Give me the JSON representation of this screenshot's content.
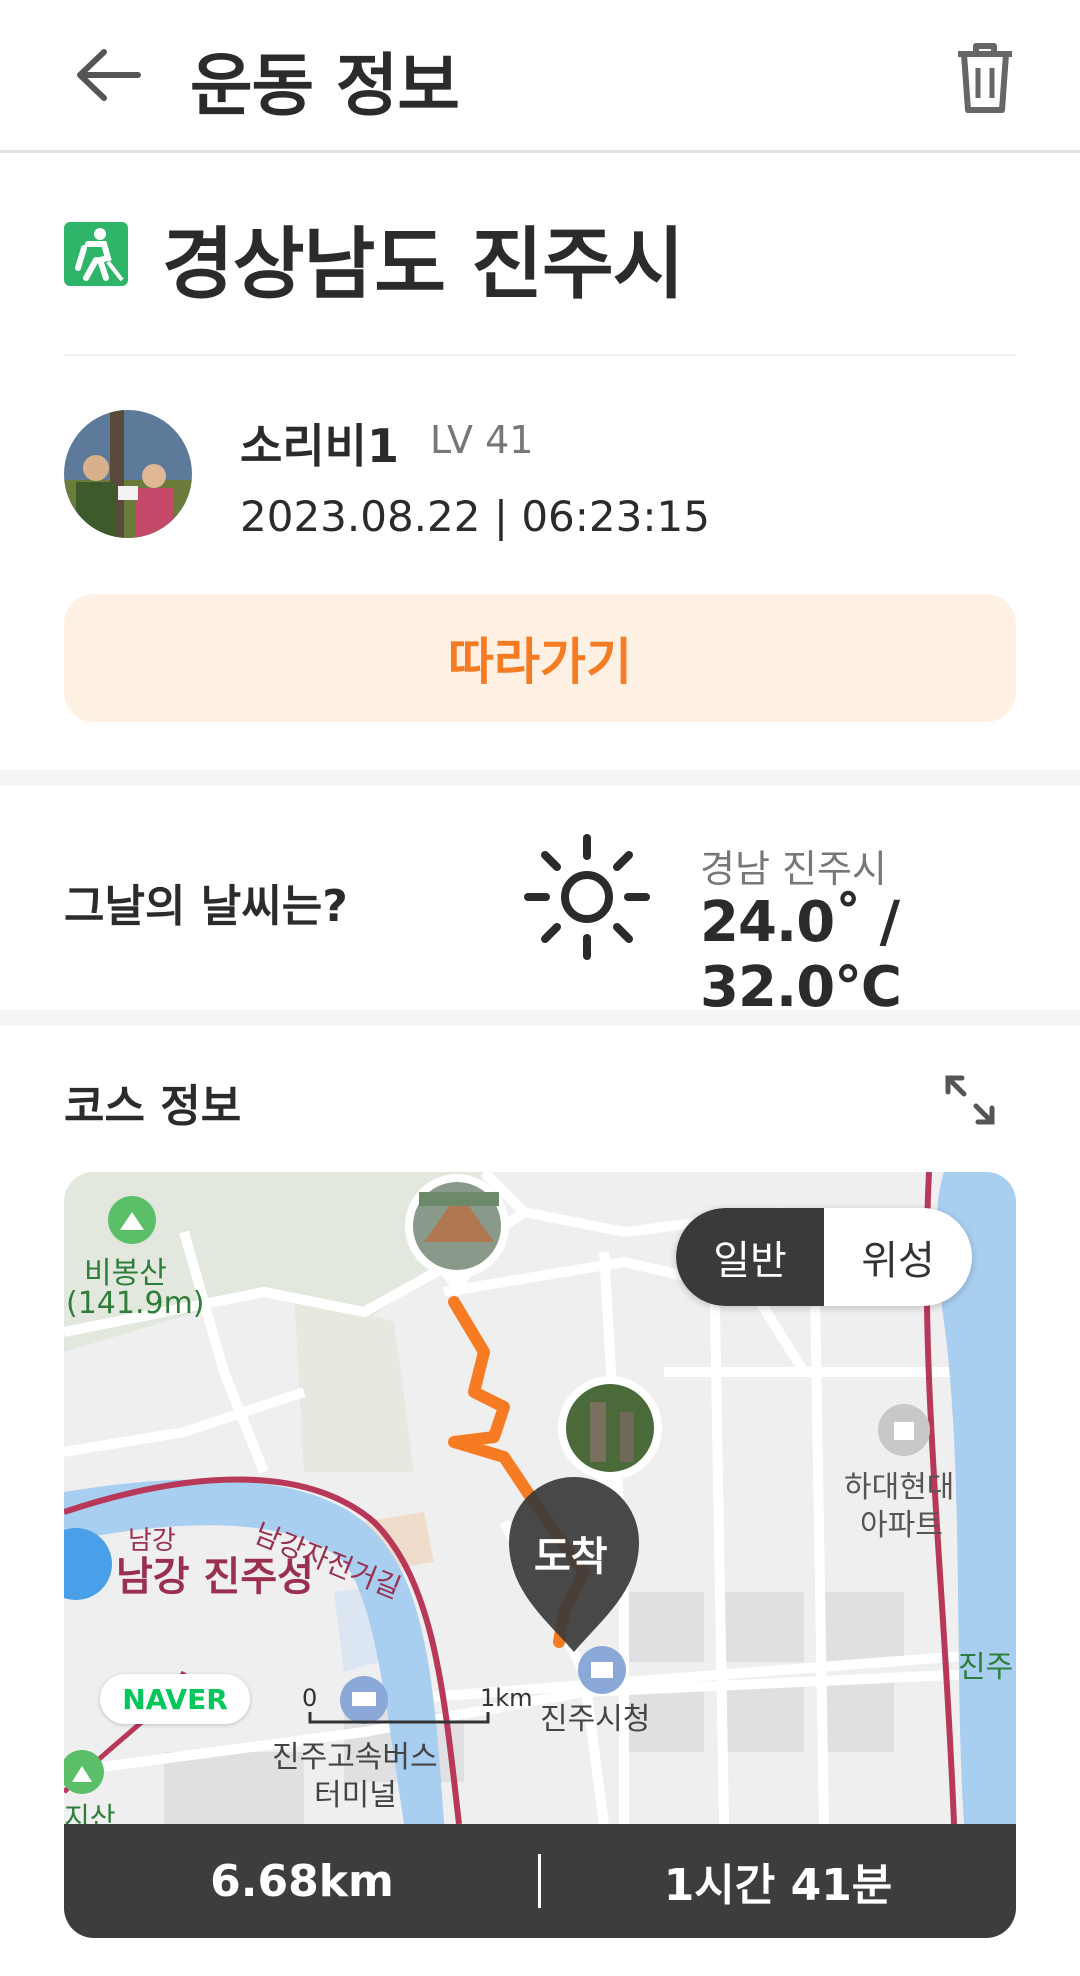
{
  "header": {
    "title": "운동 정보",
    "back_icon": "arrow-left-icon",
    "delete_icon": "trash-icon"
  },
  "location": {
    "icon": "hiking-icon",
    "title": "경상남도 진주시"
  },
  "user": {
    "name": "소리비1",
    "level": "LV 41",
    "datetime": "2023.08.22 | 06:23:15"
  },
  "follow_button": {
    "label": "따라가기",
    "bg": "#fff0e4",
    "color": "#f67b22"
  },
  "weather": {
    "question": "그날의 날씨는?",
    "icon": "sun-icon",
    "city": "경남 진주시",
    "temp": "24.0˚ / 32.0℃"
  },
  "course": {
    "title": "코스 정보",
    "expand_icon": "expand-icon",
    "map_toggle": {
      "normal": "일반",
      "satellite": "위성",
      "selected": "일반"
    },
    "map_labels": {
      "peak": "비봉산",
      "peak_height": "(141.9m)",
      "river": "남강",
      "castle": "남강 진주성",
      "bike_road": "남강자전거길",
      "arrival": "도착",
      "apt1": "하대현대",
      "apt2": "아파트",
      "city_hall": "진주시청",
      "bus1": "진주고속버스",
      "bus2": "터미널",
      "jinju": "진주",
      "scale0": "0",
      "scale1": "1km",
      "naver": "NAVER",
      "jisan": "지산"
    },
    "route_color": "#f67b22",
    "distance": "6.68km",
    "duration": "1시간 41분"
  }
}
